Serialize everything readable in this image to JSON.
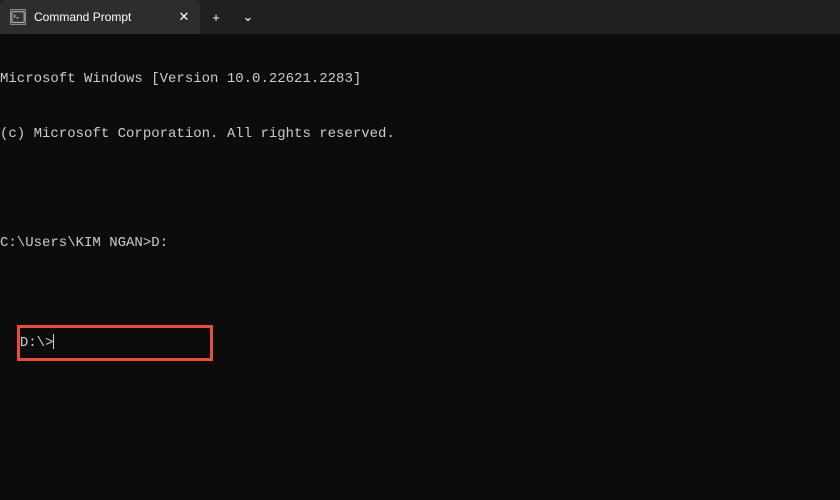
{
  "titleBar": {
    "tab": {
      "title": "Command Prompt",
      "iconName": "terminal-icon"
    },
    "newTab": "+",
    "tabDropdown": "⌄",
    "close": "✕"
  },
  "terminal": {
    "line1": "Microsoft Windows [Version 10.0.22621.2283]",
    "line2": "(c) Microsoft Corporation. All rights reserved.",
    "prompt1": "C:\\Users\\KIM NGAN>",
    "command1": "D:",
    "prompt2": "D:\\>"
  },
  "highlight": {
    "color": "#e74c3c"
  }
}
